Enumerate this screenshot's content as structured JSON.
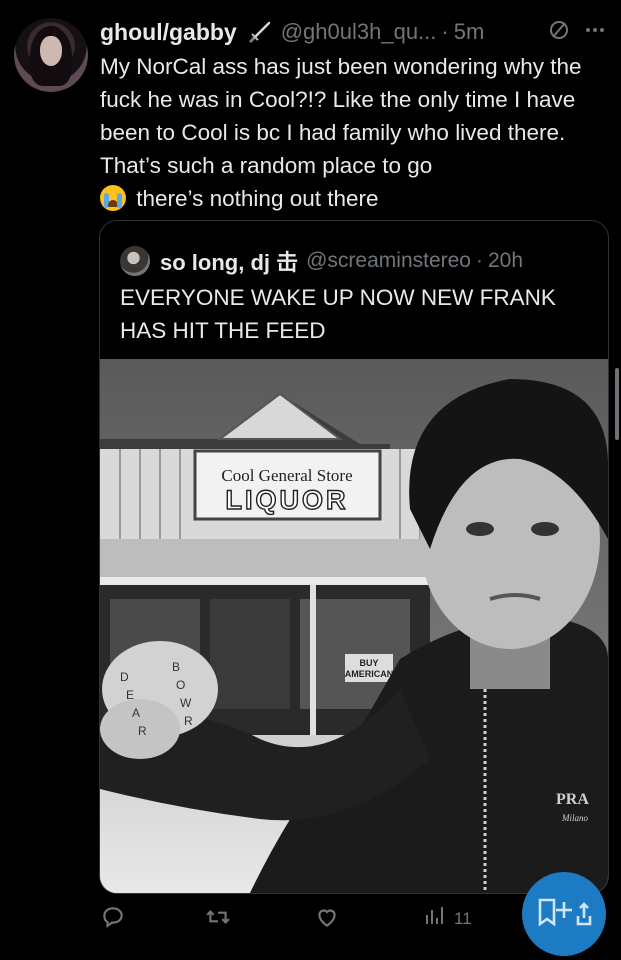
{
  "tweet": {
    "display_name": "ghoul/gabby",
    "handle": "@gh0ul3h_qu...",
    "separator": "·",
    "timestamp": "5m",
    "text": "My NorCal ass has just been wondering why the fuck he was in Cool?!? Like the only time I have been to Cool is bc I had family who lived there. That’s such a random place to go",
    "text_after_emoji": "there’s nothing out there",
    "emoji": "loudly-crying-face",
    "icons": [
      "dagger-icon",
      "muted-circle-icon",
      "more-dots-icon"
    ]
  },
  "quote": {
    "display_name": "so long, dj 击",
    "handle": "@screaminstereo",
    "separator": "·",
    "timestamp": "20h",
    "text": "EVERYONE WAKE UP NOW NEW FRANK HAS HIT THE FEED",
    "photo": {
      "sign_line1": "Cool General Store",
      "sign_line2": "LIQUOR",
      "window_sign1": "BUY",
      "window_sign2": "AMERICAN",
      "knuckle_tattoos": [
        "B",
        "O",
        "W",
        "R",
        "D",
        "E",
        "A",
        "R"
      ],
      "jacket_logo_line1": "PRA",
      "jacket_logo_line2": "Milano"
    }
  },
  "actions": {
    "reply_icon": "reply-icon",
    "retweet_icon": "retweet-icon",
    "like_icon": "heart-icon",
    "views_icon": "bar-chart-icon",
    "views_count": "11",
    "fab_icon": "compose-plus-icon"
  },
  "colors": {
    "background": "#000000",
    "text": "#e7e9ea",
    "muted": "#71767b",
    "border": "#2f3336",
    "fab": "#1d7bc4"
  }
}
